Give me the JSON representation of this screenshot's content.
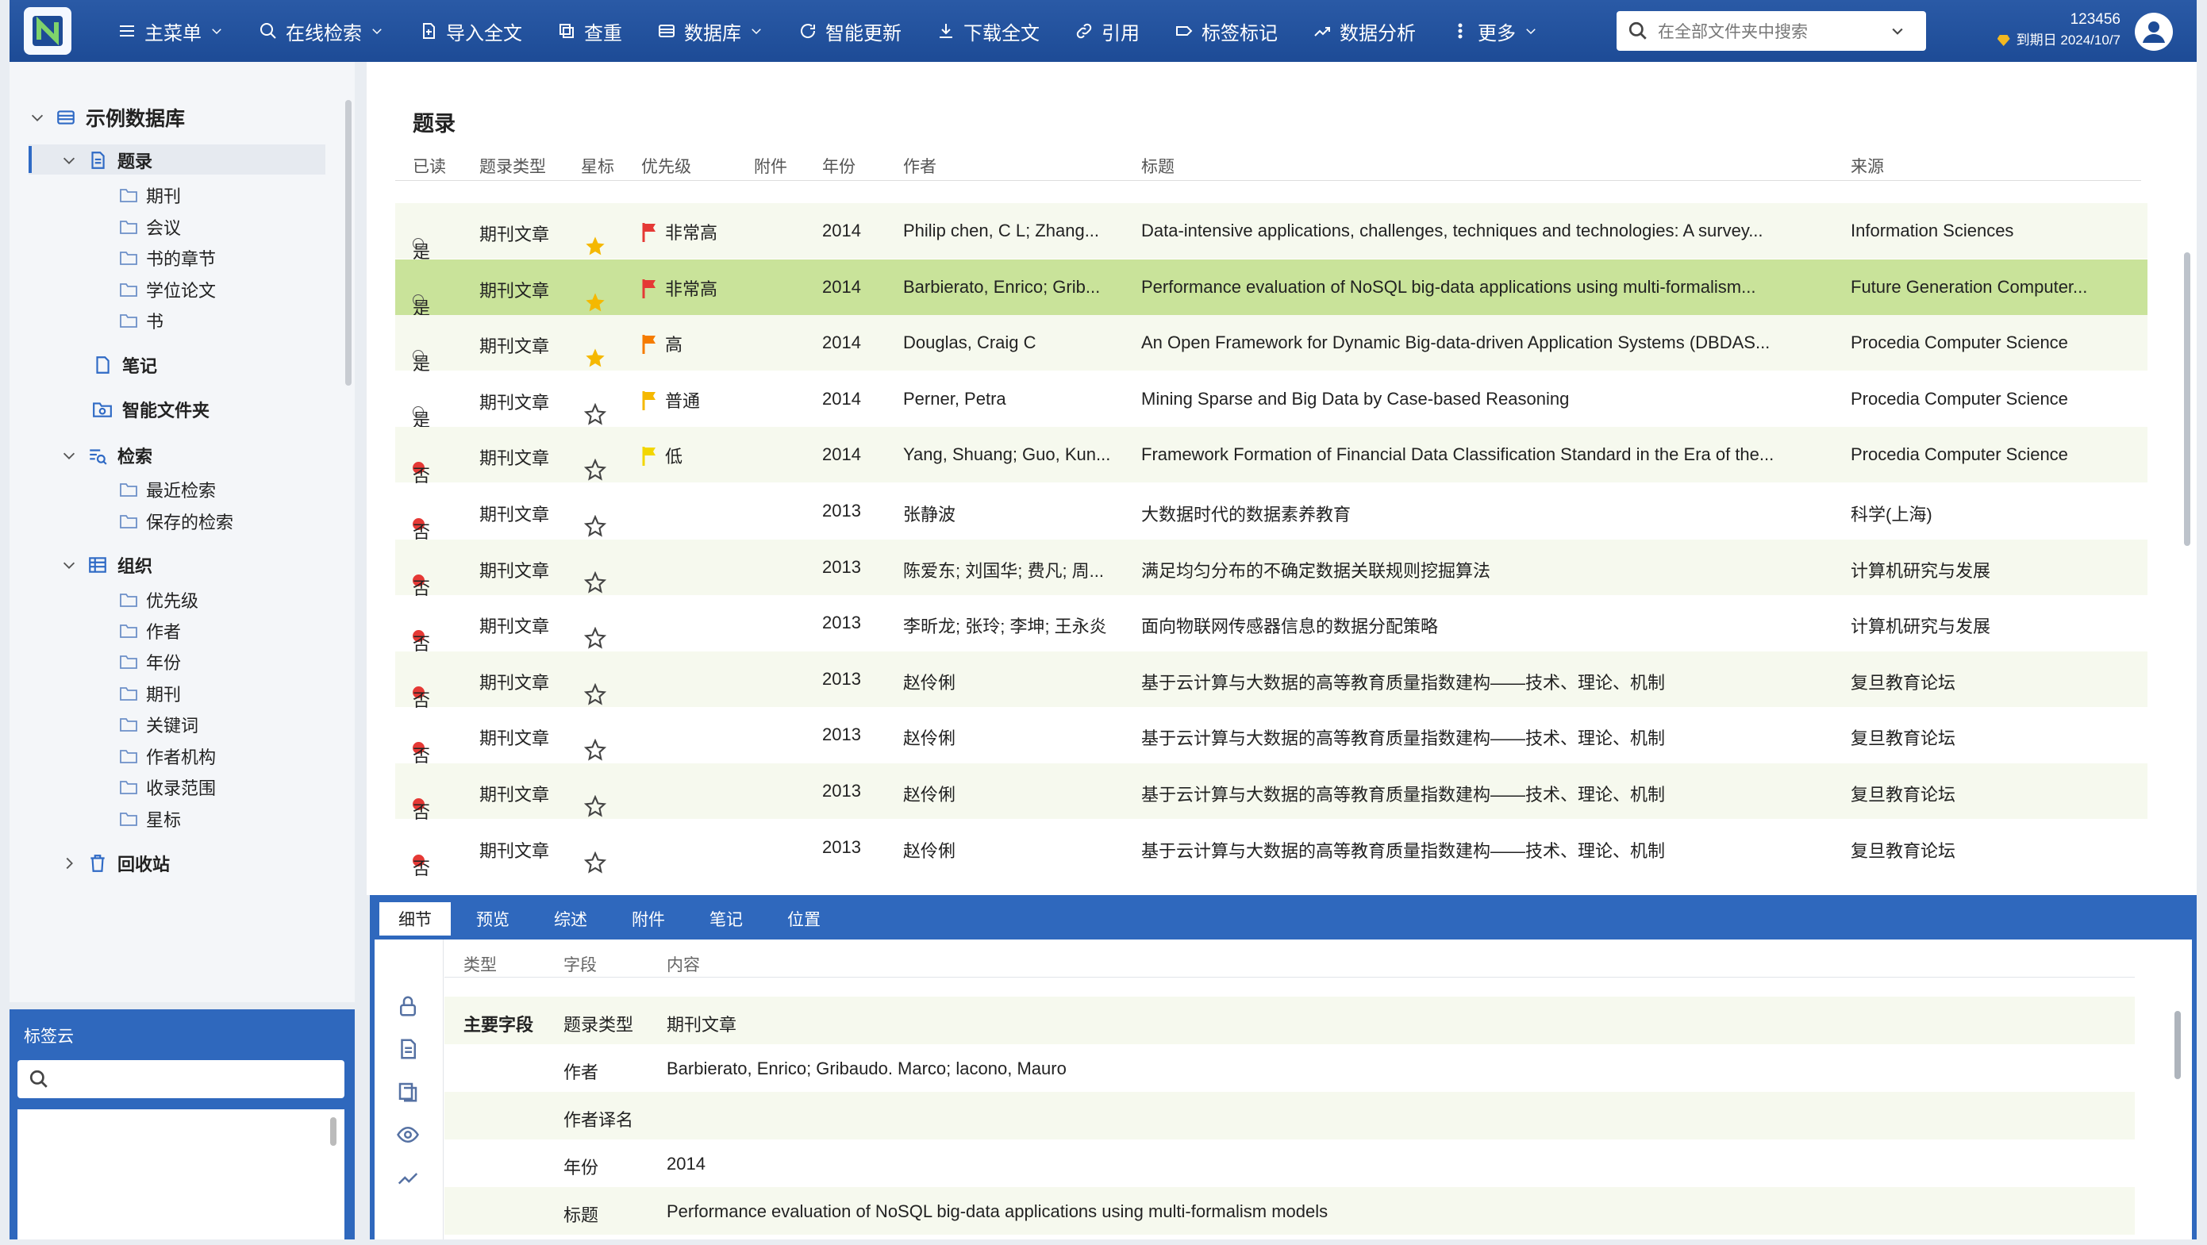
{
  "topbar": {
    "menu": [
      {
        "label": "主菜单",
        "icon": "menu-icon",
        "dropdown": true
      },
      {
        "label": "在线检索",
        "icon": "search-icon",
        "dropdown": true
      },
      {
        "label": "导入全文",
        "icon": "import-icon",
        "dropdown": false
      },
      {
        "label": "查重",
        "icon": "duplicate-icon",
        "dropdown": false
      },
      {
        "label": "数据库",
        "icon": "database-icon",
        "dropdown": true
      },
      {
        "label": "智能更新",
        "icon": "refresh-icon",
        "dropdown": false
      },
      {
        "label": "下载全文",
        "icon": "download-icon",
        "dropdown": false
      },
      {
        "label": "引用",
        "icon": "link-icon",
        "dropdown": false
      },
      {
        "label": "标签标记",
        "icon": "tag-icon",
        "dropdown": false
      },
      {
        "label": "数据分析",
        "icon": "chart-icon",
        "dropdown": false
      },
      {
        "label": "更多",
        "icon": "more-icon",
        "dropdown": true
      }
    ],
    "search_placeholder": "在全部文件夹中搜索",
    "user_id": "123456",
    "expiry": "到期日 2024/10/7"
  },
  "tree": {
    "root": "示例数据库",
    "items": [
      {
        "label": "题录"
      },
      {
        "label": "期刊"
      },
      {
        "label": "会议"
      },
      {
        "label": "书的章节"
      },
      {
        "label": "学位论文"
      },
      {
        "label": "书"
      },
      {
        "label": "笔记"
      },
      {
        "label": "智能文件夹"
      },
      {
        "label": "检索"
      },
      {
        "label": "最近检索"
      },
      {
        "label": "保存的检索"
      },
      {
        "label": "组织"
      },
      {
        "label": "优先级"
      },
      {
        "label": "作者"
      },
      {
        "label": "年份"
      },
      {
        "label": "期刊"
      },
      {
        "label": "关键词"
      },
      {
        "label": "作者机构"
      },
      {
        "label": "收录范围"
      },
      {
        "label": "星标"
      },
      {
        "label": "回收站"
      }
    ]
  },
  "tagcloud": {
    "title": "标签云"
  },
  "main": {
    "title": "题录",
    "columns": [
      "已读",
      "题录类型",
      "星标",
      "优先级",
      "附件",
      "年份",
      "作者",
      "标题",
      "来源"
    ],
    "rows": [
      {
        "read": "是",
        "type": "期刊文章",
        "starred": true,
        "priority": "非常高",
        "flag_color": "#e53935",
        "year": "2014",
        "author": "Philip chen, C L; Zhang...",
        "title": "Data-intensive applications, challenges, techniques and technologies: A survey...",
        "source": "Information Sciences"
      },
      {
        "read": "是",
        "type": "期刊文章",
        "starred": true,
        "priority": "非常高",
        "flag_color": "#e53935",
        "year": "2014",
        "author": "Barbierato, Enrico; Grib...",
        "title": "Performance evaluation of NoSQL big-data applications using multi-formalism...",
        "source": "Future Generation Computer..."
      },
      {
        "read": "是",
        "type": "期刊文章",
        "starred": true,
        "priority": "高",
        "flag_color": "#f57c00",
        "year": "2014",
        "author": "Douglas, Craig C",
        "title": "An Open Framework for Dynamic Big-data-driven Application Systems (DBDAS...",
        "source": "Procedia Computer Science"
      },
      {
        "read": "是",
        "type": "期刊文章",
        "starred": false,
        "priority": "普通",
        "flag_color": "#f5b800",
        "year": "2014",
        "author": "Perner, Petra",
        "title": "Mining Sparse and Big Data by Case-based Reasoning",
        "source": "Procedia Computer Science"
      },
      {
        "read": "否",
        "type": "期刊文章",
        "starred": false,
        "priority": "低",
        "flag_color": "#f2d600",
        "year": "2014",
        "author": "Yang, Shuang; Guo, Kun...",
        "title": "Framework Formation of Financial Data Classification Standard in the Era of the...",
        "source": "Procedia Computer Science"
      },
      {
        "read": "否",
        "type": "期刊文章",
        "starred": false,
        "priority": "",
        "flag_color": "",
        "year": "2013",
        "author": "张静波",
        "title": "大数据时代的数据素养教育",
        "source": "科学(上海)"
      },
      {
        "read": "否",
        "type": "期刊文章",
        "starred": false,
        "priority": "",
        "flag_color": "",
        "year": "2013",
        "author": "陈爱东; 刘国华; 费凡; 周...",
        "title": "满足均匀分布的不确定数据关联规则挖掘算法",
        "source": "计算机研究与发展"
      },
      {
        "read": "否",
        "type": "期刊文章",
        "starred": false,
        "priority": "",
        "flag_color": "",
        "year": "2013",
        "author": "李昕龙; 张玲; 李坤; 王永炎",
        "title": "面向物联网传感器信息的数据分配策略",
        "source": "计算机研究与发展"
      },
      {
        "read": "否",
        "type": "期刊文章",
        "starred": false,
        "priority": "",
        "flag_color": "",
        "year": "2013",
        "author": "赵伶俐",
        "title": "基于云计算与大数据的高等教育质量指数建构——技术、理论、机制",
        "source": "复旦教育论坛"
      },
      {
        "read": "否",
        "type": "期刊文章",
        "starred": false,
        "priority": "",
        "flag_color": "",
        "year": "2013",
        "author": "赵伶俐",
        "title": "基于云计算与大数据的高等教育质量指数建构——技术、理论、机制",
        "source": "复旦教育论坛"
      },
      {
        "read": "否",
        "type": "期刊文章",
        "starred": false,
        "priority": "",
        "flag_color": "",
        "year": "2013",
        "author": "赵伶俐",
        "title": "基于云计算与大数据的高等教育质量指数建构——技术、理论、机制",
        "source": "复旦教育论坛"
      },
      {
        "read": "否",
        "type": "期刊文章",
        "starred": false,
        "priority": "",
        "flag_color": "",
        "year": "2013",
        "author": "赵伶俐",
        "title": "基于云计算与大数据的高等教育质量指数建构——技术、理论、机制",
        "source": "复旦教育论坛"
      }
    ]
  },
  "details": {
    "tabs": [
      "细节",
      "预览",
      "综述",
      "附件",
      "笔记",
      "位置"
    ],
    "columns": [
      "类型",
      "字段",
      "内容"
    ],
    "group_label": "主要字段",
    "fields": [
      {
        "field": "题录类型",
        "value": "期刊文章"
      },
      {
        "field": "作者",
        "value": "Barbierato, Enrico; Gribaudo. Marco; lacono, Mauro"
      },
      {
        "field": "作者译名",
        "value": ""
      },
      {
        "field": "年份",
        "value": "2014"
      },
      {
        "field": "标题",
        "value": "Performance evaluation of NoSQL big-data applications using multi-formalism models"
      }
    ]
  },
  "colors": {
    "accent": "#2f68bd",
    "selected_row": "#c9e39a",
    "alt_row": "#f6f9ee",
    "star": "#f5b800"
  }
}
